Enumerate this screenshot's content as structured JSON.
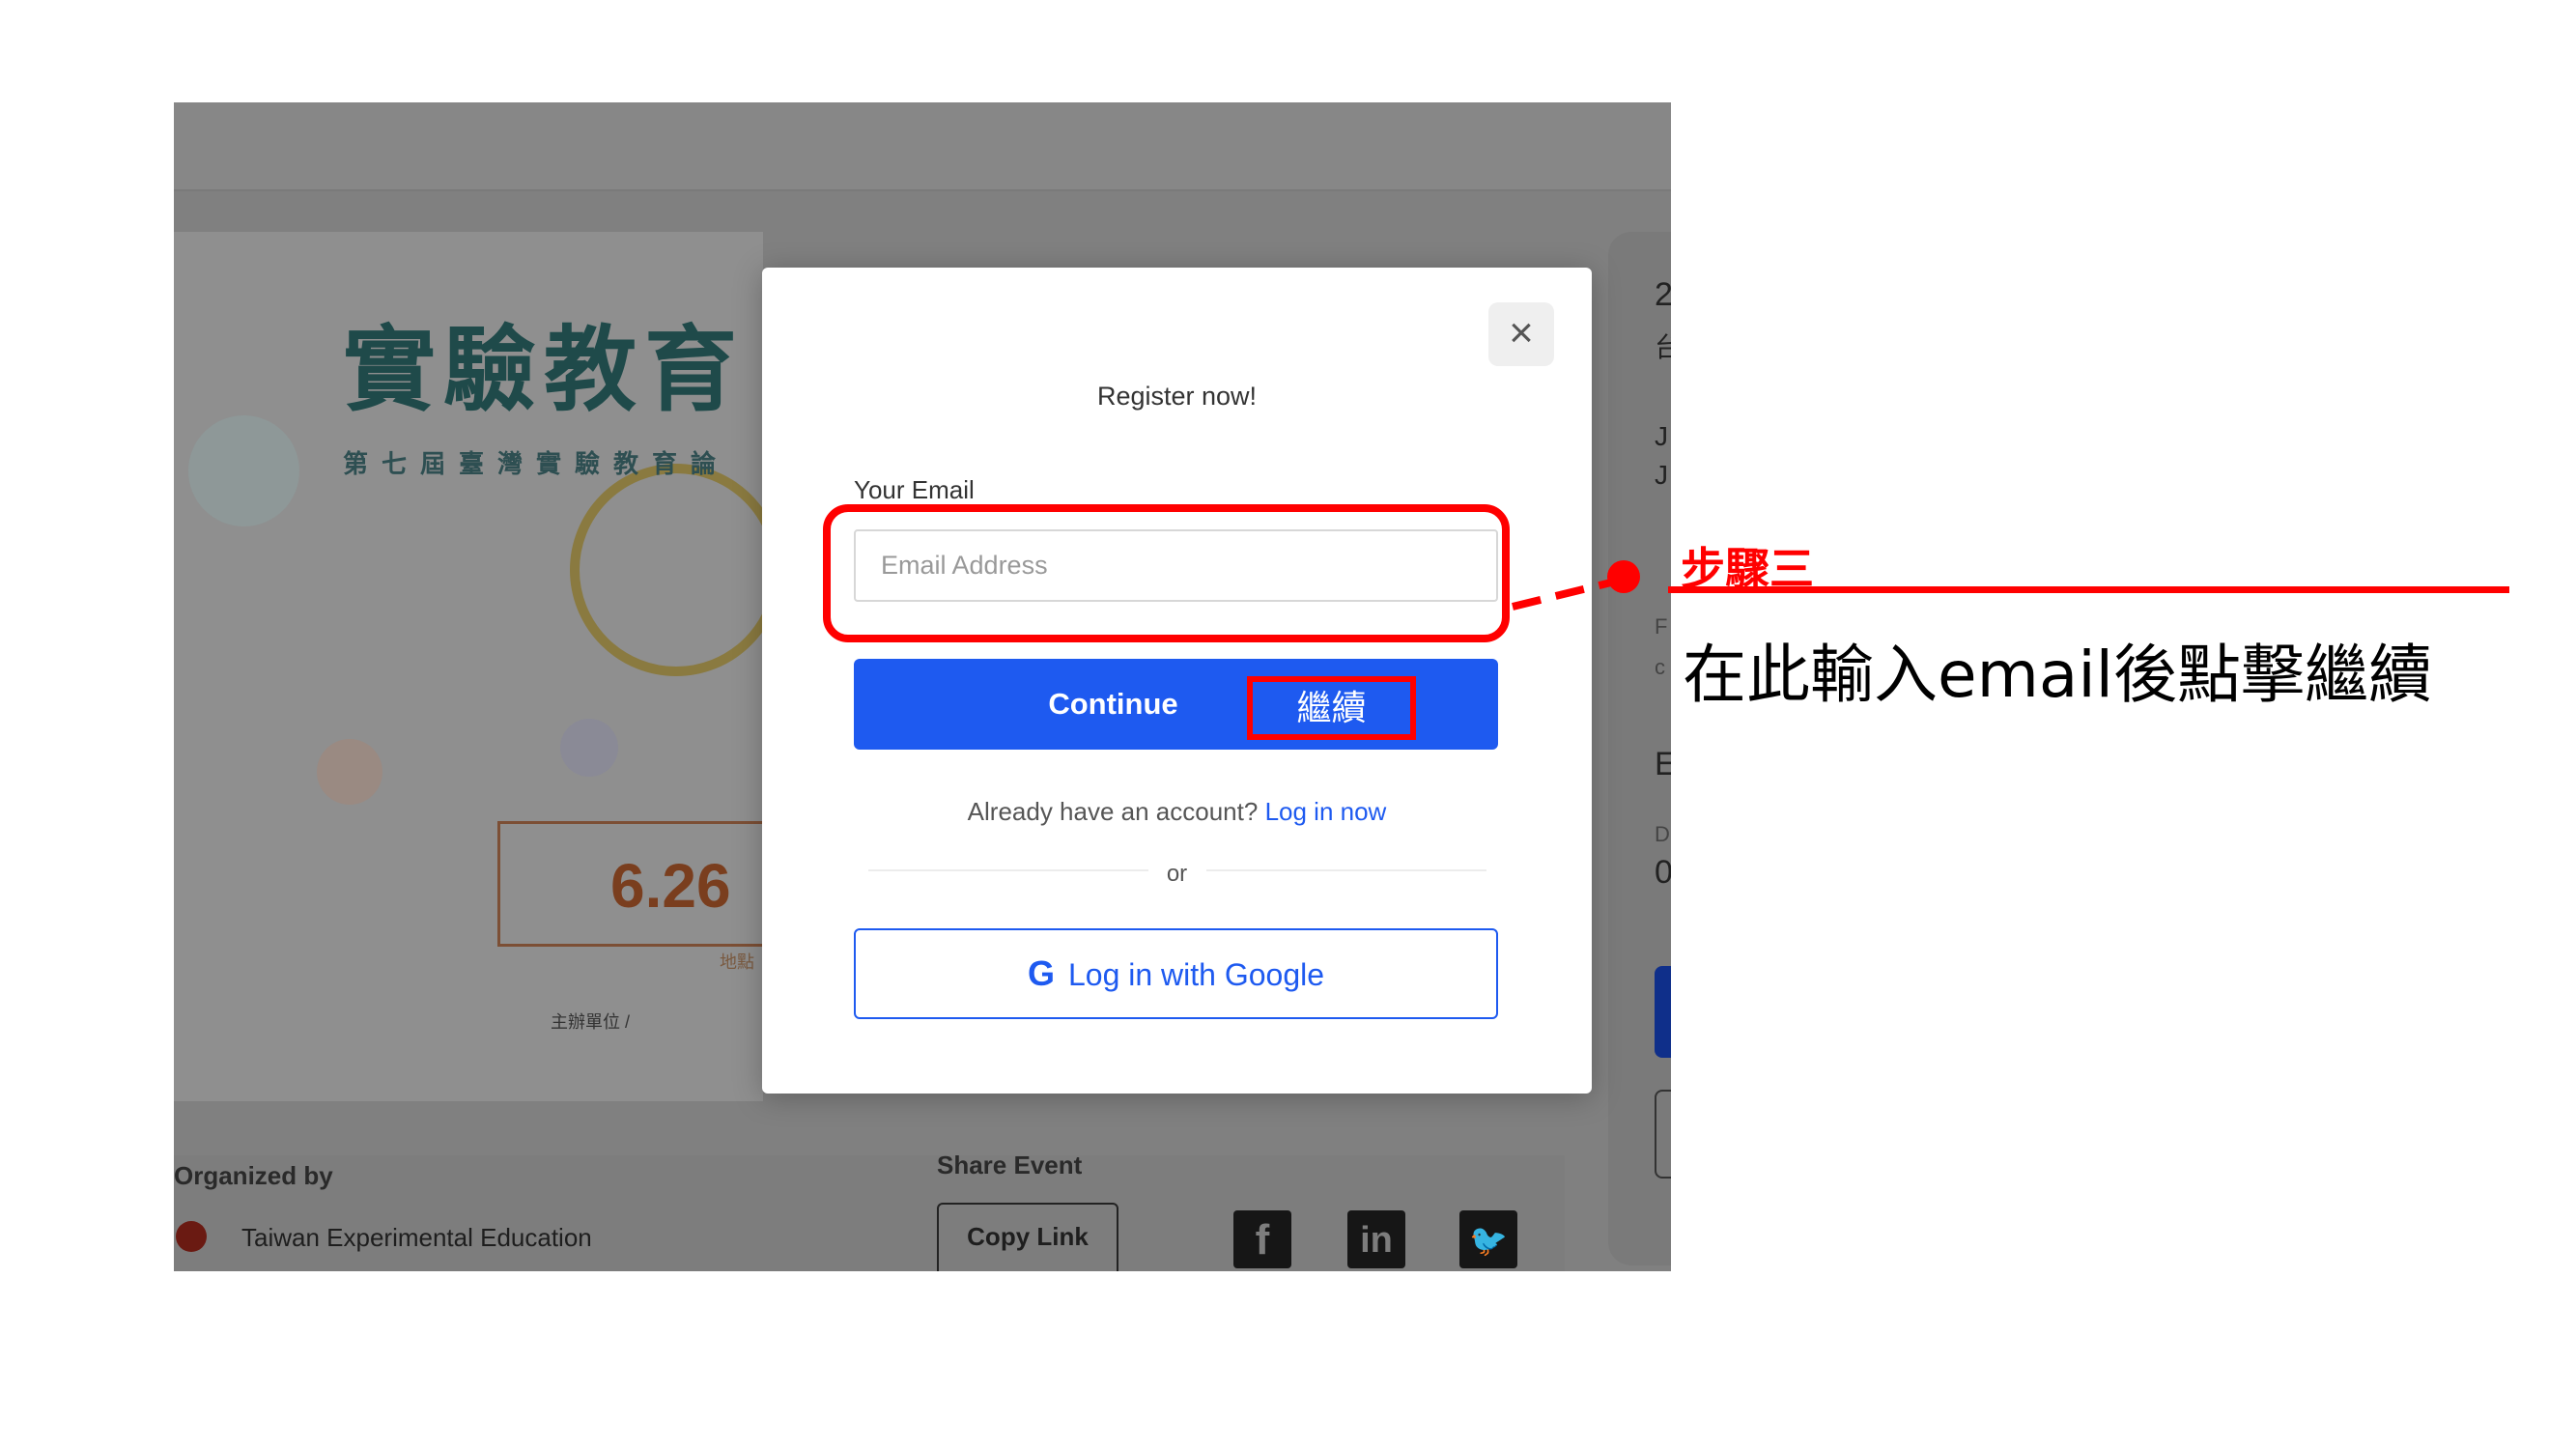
{
  "modal": {
    "title": "Register now!",
    "email_label": "Your Email",
    "email_placeholder": "Email Address",
    "email_value": "",
    "continue_label": "Continue",
    "already_text": "Already have an account?",
    "login_link": "Log in now",
    "divider_text": "or",
    "google_icon_glyph": "G",
    "google_label": "Log in with Google",
    "close_glyph": "×"
  },
  "background_page": {
    "poster_title": "實驗教育",
    "poster_subtitle": "第七屆臺灣實驗教育論",
    "poster_date": "6.26",
    "poster_location_label": "地點",
    "poster_organizer": "主辦單位 /",
    "organized_by_label": "Organized by",
    "organizer_name": "Taiwan Experimental Education",
    "share_label": "Share Event",
    "copy_link_label": "Copy Link",
    "right_panel_fragments": [
      "2",
      "台",
      "J",
      "J",
      "F",
      "c",
      "E",
      "D",
      "0"
    ],
    "social": [
      {
        "name": "facebook-icon",
        "glyph": "f"
      },
      {
        "name": "linkedin-icon",
        "glyph": "in"
      },
      {
        "name": "twitter-icon",
        "glyph": "🐦"
      }
    ]
  },
  "annotation": {
    "continue_cn": "繼續",
    "step_label": "步驟三",
    "instruction": "在此輸入email後點擊繼續",
    "color": "#ff0000"
  },
  "colors": {
    "primary": "#1e5af0",
    "overlay": "#808080"
  }
}
